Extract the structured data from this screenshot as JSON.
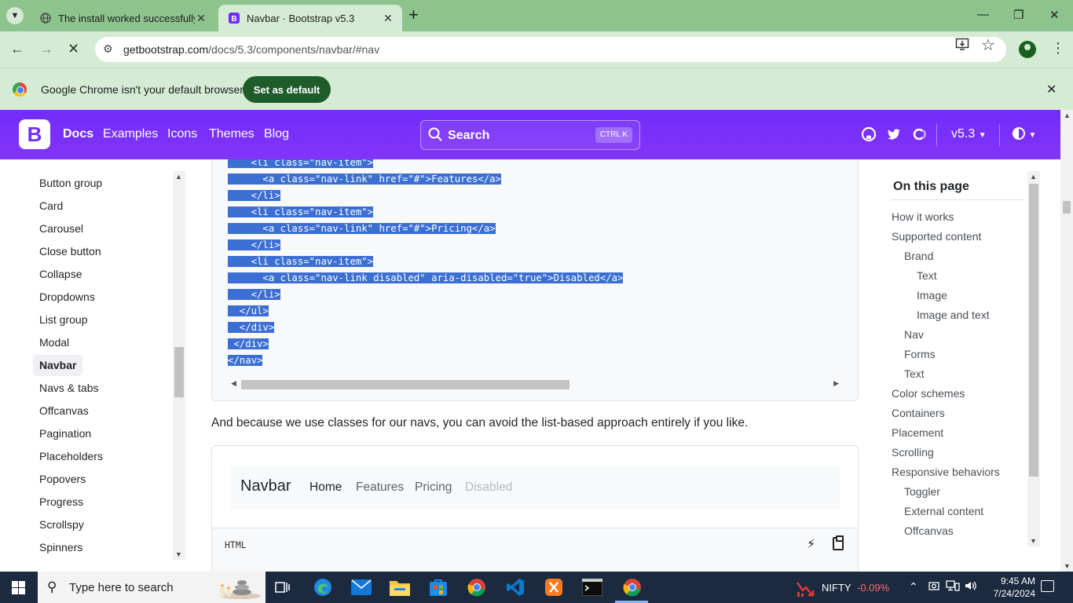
{
  "browser": {
    "tabs": [
      {
        "title": "The install worked successfully!"
      },
      {
        "title": "Navbar · Bootstrap v5.3"
      }
    ],
    "url_host": "getbootstrap.com",
    "url_path": "/docs/5.3/components/navbar/#nav",
    "infobar": {
      "message": "Google Chrome isn't your default browser",
      "button": "Set as default"
    }
  },
  "bd_nav": {
    "logo": "B",
    "links": [
      "Docs",
      "Examples",
      "Icons",
      "Themes",
      "Blog"
    ],
    "search_placeholder": "Search",
    "shortcut": "CTRL K",
    "version": "v5.3"
  },
  "sidebar": {
    "items": [
      "Button group",
      "Card",
      "Carousel",
      "Close button",
      "Collapse",
      "Dropdowns",
      "List group",
      "Modal",
      "Navbar",
      "Navs & tabs",
      "Offcanvas",
      "Pagination",
      "Placeholders",
      "Popovers",
      "Progress",
      "Scrollspy",
      "Spinners"
    ],
    "active": "Navbar"
  },
  "code": {
    "lines": [
      "    </li>",
      "    <li class=\"nav-item\">",
      "      <a class=\"nav-link\" href=\"#\">Features</a>",
      "    </li>",
      "    <li class=\"nav-item\">",
      "      <a class=\"nav-link\" href=\"#\">Pricing</a>",
      "    </li>",
      "    <li class=\"nav-item\">",
      "      <a class=\"nav-link disabled\" aria-disabled=\"true\">Disabled</a>",
      "    </li>",
      "  </ul>",
      "  </div>",
      " </div>",
      "</nav>"
    ]
  },
  "content": {
    "paragraph": "And because we use classes for our navs, you can avoid the list-based approach entirely if you like.",
    "demo": {
      "brand": "Navbar",
      "links": [
        {
          "label": "Home",
          "state": "active"
        },
        {
          "label": "Features",
          "state": "normal"
        },
        {
          "label": "Pricing",
          "state": "normal"
        },
        {
          "label": "Disabled",
          "state": "disabled"
        }
      ]
    },
    "code_label": "HTML"
  },
  "toc": {
    "title": "On this page",
    "items": [
      {
        "label": "How it works",
        "level": 0
      },
      {
        "label": "Supported content",
        "level": 0
      },
      {
        "label": "Brand",
        "level": 1
      },
      {
        "label": "Text",
        "level": 2
      },
      {
        "label": "Image",
        "level": 2
      },
      {
        "label": "Image and text",
        "level": 2
      },
      {
        "label": "Nav",
        "level": 1
      },
      {
        "label": "Forms",
        "level": 1
      },
      {
        "label": "Text",
        "level": 1
      },
      {
        "label": "Color schemes",
        "level": 0
      },
      {
        "label": "Containers",
        "level": 0
      },
      {
        "label": "Placement",
        "level": 0
      },
      {
        "label": "Scrolling",
        "level": 0
      },
      {
        "label": "Responsive behaviors",
        "level": 0
      },
      {
        "label": "Toggler",
        "level": 1
      },
      {
        "label": "External content",
        "level": 1
      },
      {
        "label": "Offcanvas",
        "level": 1
      }
    ]
  },
  "taskbar": {
    "search_placeholder": "Type here to search",
    "ticker_name": "NIFTY",
    "ticker_change": "-0.09%",
    "time": "9:45 AM",
    "date": "7/24/2024"
  },
  "colors": {
    "bootstrap_purple": "#712cf9",
    "chrome_frame": "#8dc38d",
    "selection": "#3b6fd3"
  }
}
